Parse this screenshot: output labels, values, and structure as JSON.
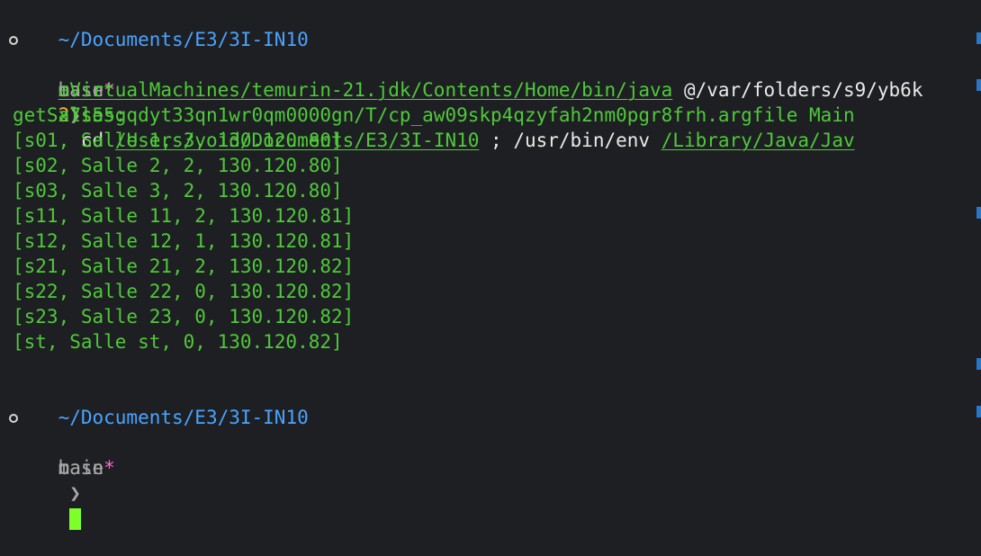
{
  "terminal": {
    "session1": {
      "cwd": "~/Documents/E3/3I-IN10",
      "branch": "main",
      "dirty": "*",
      "duration": "27s",
      "env": "base",
      "chevron": "❯",
      "cmd_prefix": "cd ",
      "path1": "/Users/void/Documents/E3/3I-IN10",
      "mid": " ; /usr/bin/env ",
      "java_path_part1": "/Library/Java/Jav",
      "java_path_part2": "aVirtualMachines/temurin-21.jdk/Contents/Home/bin/java",
      "argfile_part1": " @/var/folders/s9/yb6k",
      "argfile_part2": "x7s55gqdyt33qn1wr0qm0000gn/T/cp_aw09skp4qzyfah2nm0pgr8frh.argfile",
      "main_class": " Main"
    },
    "output": {
      "header": "getSalles:",
      "rows": [
        "[s01, Salle 1, 3, 130.120.80]",
        "[s02, Salle 2, 2, 130.120.80]",
        "[s03, Salle 3, 2, 130.120.80]",
        "[s11, Salle 11, 2, 130.120.81]",
        "[s12, Salle 12, 1, 130.120.81]",
        "[s21, Salle 21, 2, 130.120.82]",
        "[s22, Salle 22, 0, 130.120.82]",
        "[s23, Salle 23, 0, 130.120.82]",
        "[st, Salle st, 0, 130.120.82]"
      ]
    },
    "session2": {
      "cwd": "~/Documents/E3/3I-IN10",
      "branch": "main",
      "dirty": "*",
      "env": "base",
      "chevron": "❯"
    },
    "colors": {
      "background": "#1e1f22",
      "path_blue": "#4aa3ff",
      "output_green": "#4fc93a",
      "branch_gray": "#a7a7a7",
      "dirty_pink": "#ff63d3",
      "duration_orange": "#ffb020",
      "cursor": "#7fff2a"
    },
    "icons": {
      "prompt_status": "prompt-circle-icon",
      "scroll_marker": "scroll-marker-icon",
      "cursor": "cursor-block-icon"
    }
  }
}
